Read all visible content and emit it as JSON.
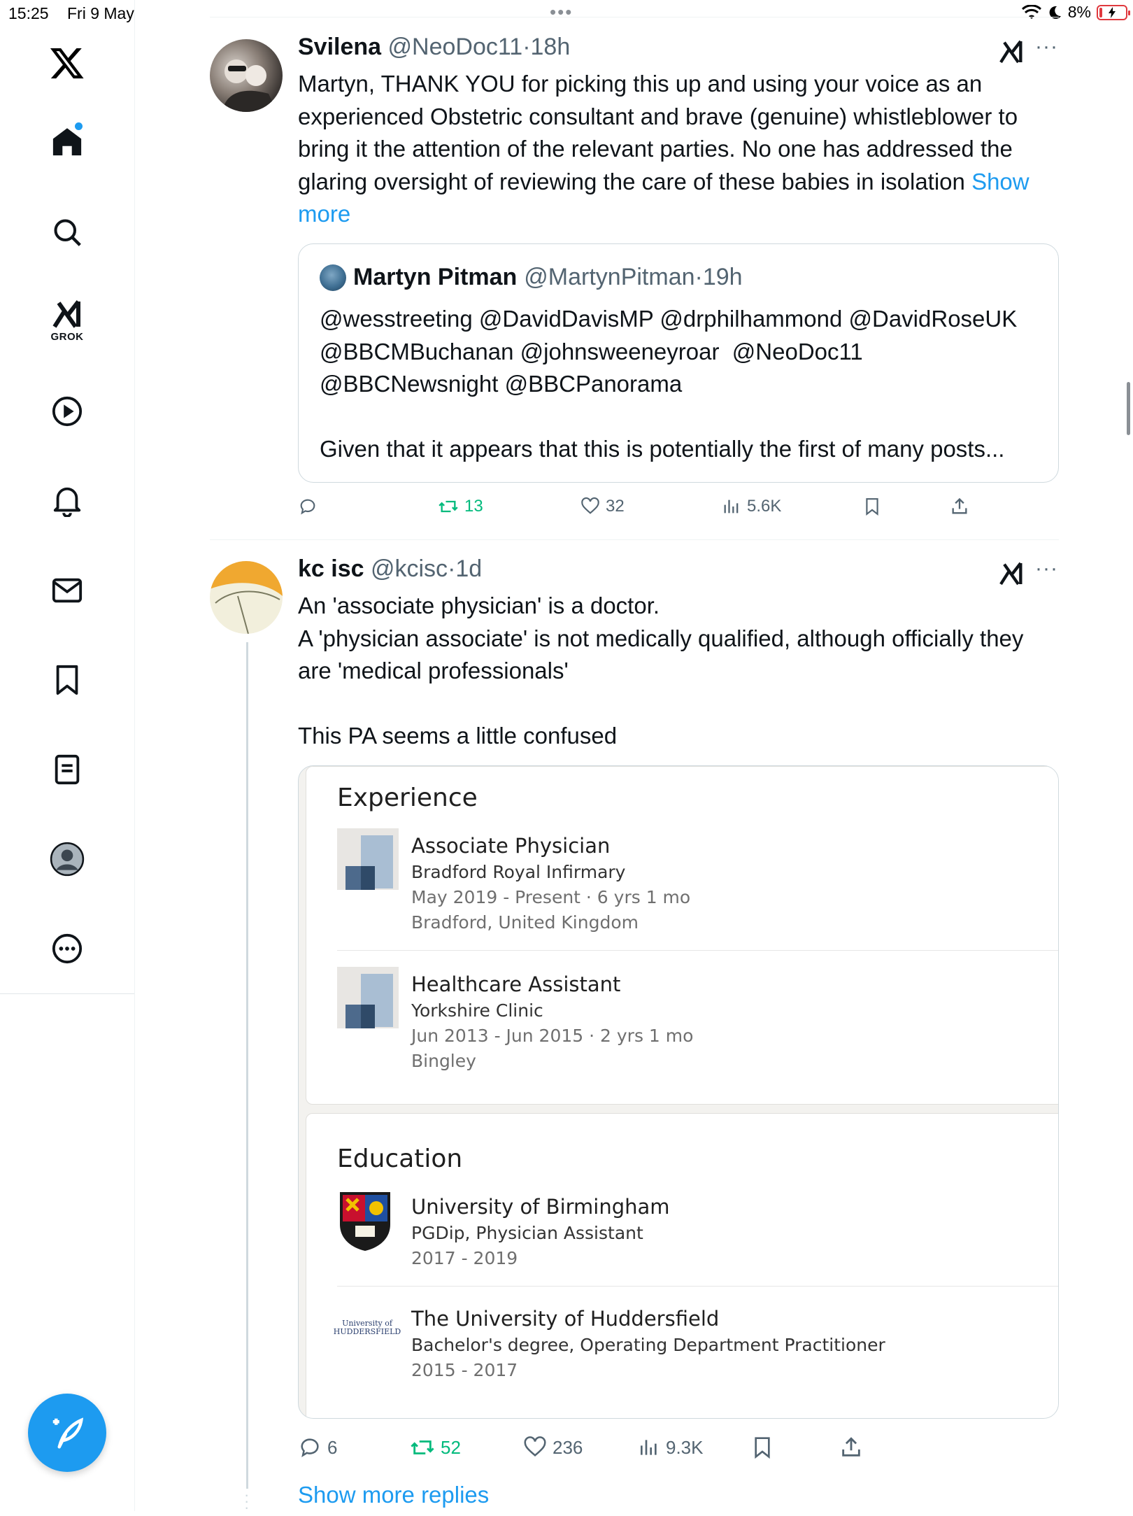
{
  "status_bar": {
    "time": "15:25",
    "date": "Fri 9 May",
    "battery": "8%"
  },
  "sidebar": {
    "items": [
      {
        "name": "x-logo"
      },
      {
        "name": "home"
      },
      {
        "name": "search"
      },
      {
        "name": "grok",
        "label": "GROK"
      },
      {
        "name": "video"
      },
      {
        "name": "notifications"
      },
      {
        "name": "messages"
      },
      {
        "name": "bookmarks"
      },
      {
        "name": "lists"
      },
      {
        "name": "profile"
      },
      {
        "name": "more"
      }
    ]
  },
  "tweet1": {
    "name": "Svilena",
    "handle": "@NeoDoc11",
    "dot": "·",
    "time": "18h",
    "text": "Martyn, THANK YOU for picking this up and using your voice as an experienced Obstetric consultant and brave (genuine) whistleblower to bring it the attention of the relevant parties. No one has addressed the glaring oversight of reviewing the care of these babies in isolation",
    "show_more": "Show more",
    "quote": {
      "name": "Martyn Pitman",
      "handle": "@MartynPitman",
      "dot": "·",
      "time": "19h",
      "mentions_line1": "@wesstreeting @DavidDavisMP @drphilhammond @DavidRoseUK",
      "mentions_line2": "@BBCMBuchanan @johnsweeneyroar  @NeoDoc11",
      "mentions_line3": "@BBCNewsnight @BBCPanorama",
      "body": "Given that it appears that this is potentially the first of many posts..."
    },
    "stats": {
      "replies": "",
      "reposts": "13",
      "likes": "32",
      "views": "5.6K"
    }
  },
  "tweet2": {
    "name": "kc isc",
    "handle": "@kcisc",
    "dot": "·",
    "time": "1d",
    "line1": "An 'associate physician' is a doctor.",
    "line2": "A 'physician associate' is not medically qualified, although officially they are 'medical professionals'",
    "line3": "This PA seems a little confused",
    "card": {
      "experience_title": "Experience",
      "experience": [
        {
          "title": "Associate Physician",
          "org": "Bradford Royal Infirmary",
          "dates": "May 2019 - Present · 6 yrs 1 mo",
          "location": "Bradford, United Kingdom"
        },
        {
          "title": "Healthcare Assistant",
          "org": "Yorkshire Clinic",
          "dates": "Jun 2013 - Jun 2015 · 2 yrs 1 mo",
          "location": "Bingley"
        }
      ],
      "education_title": "Education",
      "education": [
        {
          "title": "University of Birmingham",
          "degree": "PGDip, Physician Assistant",
          "dates": "2017 - 2019"
        },
        {
          "title": "The University of Huddersfield",
          "degree": "Bachelor's degree, Operating Department Practitioner",
          "dates": "2015 - 2017",
          "logo_text": "University of HUDDERSFIELD"
        }
      ]
    },
    "stats": {
      "replies": "6",
      "reposts": "52",
      "likes": "236",
      "views": "9.3K"
    }
  },
  "show_more_replies": "Show more replies",
  "colors": {
    "accent": "#1d9bf0",
    "repost": "#00ba7c",
    "muted": "#536471",
    "text": "#0f1419"
  }
}
